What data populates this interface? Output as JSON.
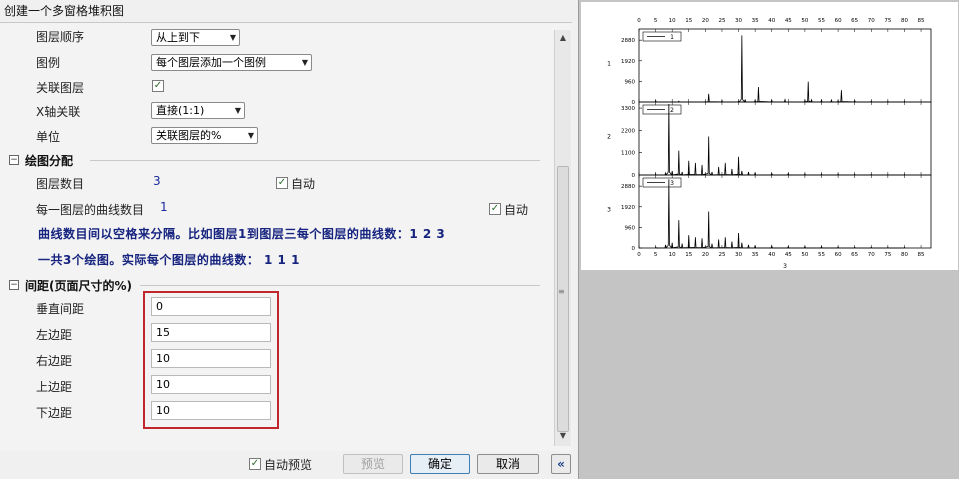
{
  "window": {
    "title": "创建一个多窗格堆积图"
  },
  "settings": {
    "layer_order": {
      "label": "图层顺序",
      "value": "从上到下"
    },
    "legend": {
      "label": "图例",
      "value": "每个图层添加一个图例"
    },
    "link_layers": {
      "label": "关联图层",
      "checked": true
    },
    "x_axis_link": {
      "label": "X轴关联",
      "value": "直接(1:1)"
    },
    "unit": {
      "label": "单位",
      "value": "关联图层的%"
    }
  },
  "plot_alloc": {
    "header": "绘图分配",
    "layers": {
      "label": "图层数目",
      "value": "3",
      "auto_label": "自动",
      "auto_checked": true
    },
    "curves": {
      "label": "每一图层的曲线数目",
      "value": "1",
      "auto_label": "自动",
      "auto_checked": true
    },
    "note1": "曲线数目间以空格来分隔。比如图层1到图层三每个图层的曲线数：1 2 3",
    "note2": "一共3个绘图。实际每个图层的曲线数： 1 1 1"
  },
  "spacing": {
    "header": "间距(页面尺寸的%)",
    "vertical": {
      "label": "垂直间距",
      "value": "0"
    },
    "left": {
      "label": "左边距",
      "value": "15"
    },
    "right": {
      "label": "右边距",
      "value": "10"
    },
    "top": {
      "label": "上边距",
      "value": "10"
    },
    "bottom": {
      "label": "下边距",
      "value": "10"
    }
  },
  "footer": {
    "auto_preview": {
      "label": "自动预览",
      "checked": true
    },
    "preview_button": "预览",
    "ok_button": "确定",
    "cancel_button": "取消",
    "collapse_button": "«"
  },
  "colors": {
    "highlight_border": "#c0272d",
    "note_text": "#16237f",
    "value_text": "#1a2a9c"
  },
  "chart_data": [
    {
      "type": "line",
      "panel": "1",
      "ylabel": "1",
      "x_ticks": [
        "0",
        "5",
        "10",
        "15",
        "20",
        "25",
        "30",
        "35",
        "40",
        "45",
        "50",
        "55",
        "60",
        "65",
        "70",
        "75",
        "80",
        "85"
      ],
      "y_ticks": [
        "0",
        "960",
        "1920",
        "2880"
      ],
      "xlim": [
        0,
        88
      ],
      "ylim": [
        0,
        3400
      ],
      "series": [
        {
          "name": "1",
          "x": [
            5,
            12,
            20,
            21,
            25,
            30,
            31,
            32,
            35,
            36,
            40,
            44,
            50,
            51,
            52,
            55,
            58,
            60,
            61,
            65,
            70,
            75,
            80
          ],
          "y": [
            80,
            40,
            30,
            380,
            60,
            40,
            3100,
            120,
            80,
            700,
            90,
            110,
            80,
            950,
            100,
            80,
            90,
            60,
            550,
            70,
            50,
            40,
            30
          ]
        }
      ]
    },
    {
      "type": "line",
      "panel": "2",
      "ylabel": "2",
      "x_ticks": [
        "0",
        "5",
        "10",
        "15",
        "20",
        "25",
        "30",
        "35",
        "40",
        "45",
        "50",
        "55",
        "60",
        "65",
        "70",
        "75",
        "80",
        "85"
      ],
      "y_ticks": [
        "0",
        "1100",
        "2200",
        "3300"
      ],
      "xlim": [
        0,
        88
      ],
      "ylim": [
        0,
        3600
      ],
      "series": [
        {
          "name": "2",
          "x": [
            5,
            8,
            9,
            10,
            12,
            13,
            15,
            17,
            19,
            21,
            22,
            24,
            26,
            28,
            30,
            31,
            33,
            35,
            40,
            45,
            50,
            55,
            60,
            65,
            70,
            75,
            80
          ],
          "y": [
            50,
            100,
            3500,
            200,
            1200,
            150,
            700,
            600,
            500,
            1900,
            150,
            400,
            600,
            300,
            900,
            200,
            150,
            120,
            90,
            80,
            60,
            50,
            50,
            40,
            40,
            30,
            30
          ]
        }
      ]
    },
    {
      "type": "line",
      "panel": "3",
      "ylabel": "3",
      "xlabel": "3",
      "x_ticks": [
        "0",
        "5",
        "10",
        "15",
        "20",
        "25",
        "30",
        "35",
        "40",
        "45",
        "50",
        "55",
        "60",
        "65",
        "70",
        "75",
        "80",
        "85"
      ],
      "y_ticks": [
        "0",
        "960",
        "1920",
        "2880"
      ],
      "xlim": [
        0,
        88
      ],
      "ylim": [
        0,
        3400
      ],
      "series": [
        {
          "name": "3",
          "x": [
            5,
            8,
            9,
            10,
            12,
            13,
            15,
            17,
            19,
            21,
            22,
            24,
            26,
            28,
            30,
            31,
            33,
            35,
            40,
            45,
            50,
            55,
            60,
            65,
            70,
            75,
            80
          ],
          "y": [
            60,
            150,
            3200,
            250,
            1300,
            200,
            600,
            500,
            450,
            1700,
            200,
            400,
            500,
            300,
            700,
            250,
            150,
            120,
            100,
            80,
            70,
            60,
            50,
            40,
            40,
            30,
            30
          ]
        }
      ]
    }
  ]
}
